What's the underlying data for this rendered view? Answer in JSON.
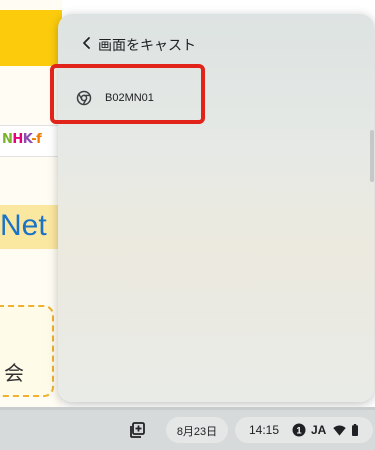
{
  "background_page": {
    "nhk_logo": "NHK-f",
    "net_banner": "Net",
    "card_text": "会"
  },
  "cast_panel": {
    "title": "画面をキャスト",
    "devices": [
      {
        "label": "B02MN01",
        "icon": "chrome-cast-icon"
      }
    ]
  },
  "shelf": {
    "date": "8月23日",
    "time": "14:15",
    "ime": "JA"
  },
  "colors": {
    "accent_yellow": "#fccc0c",
    "highlight_red": "#e2231a",
    "panel_bg": "#e4e8e5",
    "shelf_bg": "#d7dada"
  }
}
